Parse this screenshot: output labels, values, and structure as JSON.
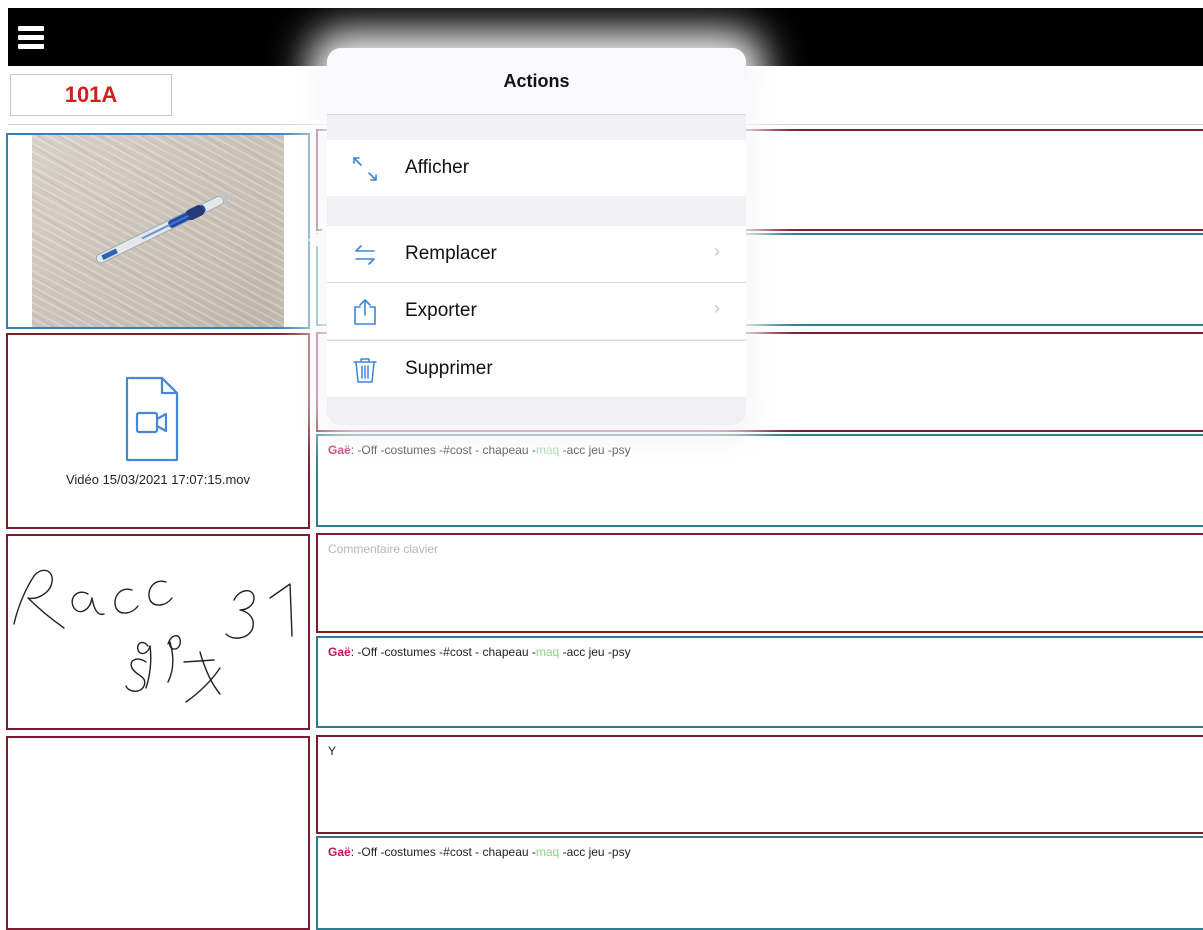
{
  "topbar": {
    "menu_icon": "hamburger-menu-icon"
  },
  "scene": {
    "label": "101A"
  },
  "media": {
    "video": {
      "caption": "Vidéo 15/03/2021 17:07:15.mov",
      "icon": "video-file-icon"
    },
    "drawing": {
      "line1": "Racc  31",
      "line2": "s89x"
    }
  },
  "notes": [
    {
      "name": "Gaë",
      "colon": ":",
      "before_maq": " -Off -costumes -#cost - chapeau -",
      "maq": "maq",
      "after_maq": " -acc jeu -psy"
    }
  ],
  "keyboard_comment": {
    "placeholder": "Commentaire clavier"
  },
  "note_y": {
    "text": "Y"
  },
  "popover": {
    "title": "Actions",
    "items": [
      {
        "label": "Afficher",
        "icon": "expand-arrows-icon",
        "has_chevron": false
      },
      {
        "label": "Remplacer",
        "icon": "swap-arrows-icon",
        "has_chevron": true
      },
      {
        "label": "Exporter",
        "icon": "share-export-icon",
        "has_chevron": true
      },
      {
        "label": "Supprimer",
        "icon": "trash-icon",
        "has_chevron": false
      }
    ],
    "chevron": "›"
  },
  "colors": {
    "accent_blue": "#3b7fb6",
    "border_maroon": "#7a1d2e",
    "border_teal": "#2a7d8c",
    "scene_red": "#d21f1f",
    "name_magenta": "#c2185b",
    "maq_green": "#8fd38f"
  }
}
